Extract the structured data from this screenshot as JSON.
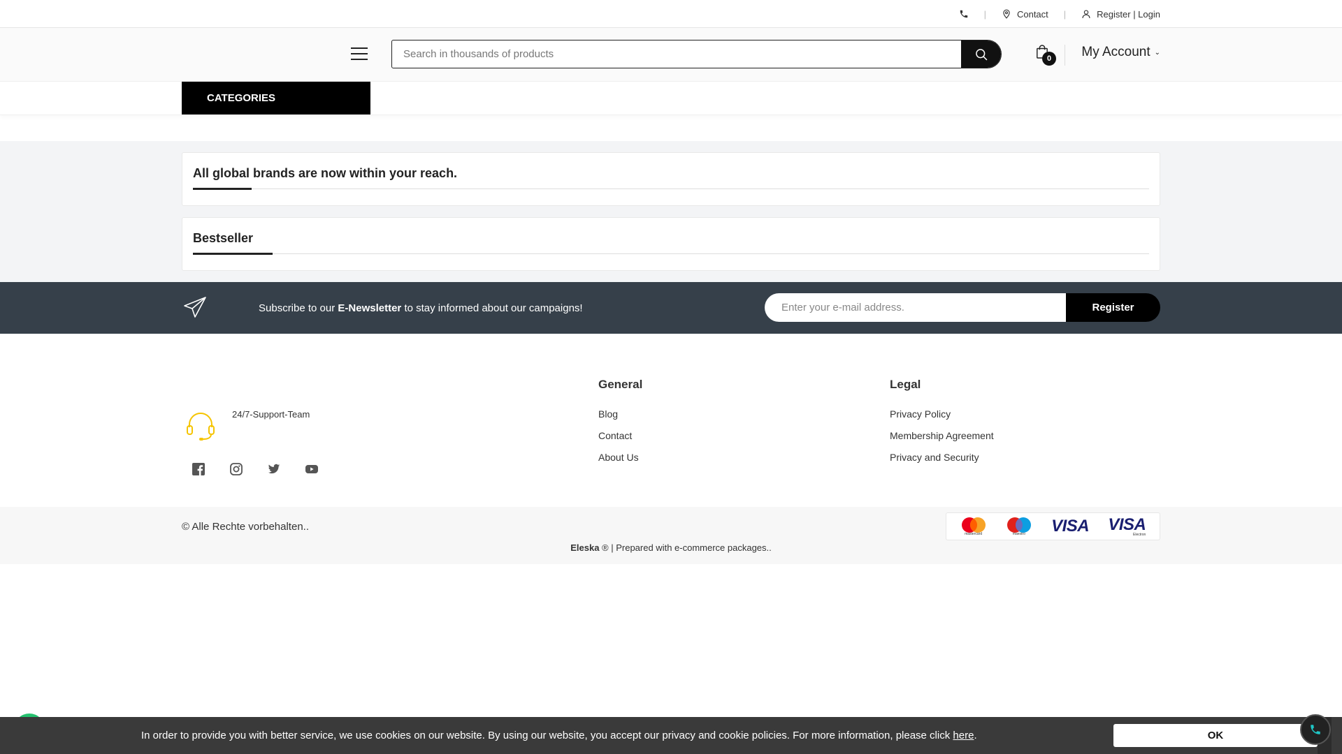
{
  "topbar": {
    "contact_label": "Contact",
    "auth_label": "Register | Login",
    "separator": "|"
  },
  "header": {
    "search_placeholder": "Search in thousands of products",
    "cart_count": "0",
    "account_label": "My Account",
    "account_glyph": "",
    "chevron": "⌄"
  },
  "nav": {
    "categories_label": "CATEGORIES",
    "categories_glyph": ""
  },
  "sections": {
    "brands_title": "All global brands are now within your reach.",
    "bestseller_title": "Bestseller"
  },
  "newsletter": {
    "text_before": "Subscribe to our ",
    "text_bold": "E-Newsletter",
    "text_after": " to stay informed about our campaigns!",
    "email_placeholder": "Enter your e-mail address.",
    "button_label": "Register"
  },
  "footer": {
    "support_text": "24/7-Support-Team",
    "general": {
      "title": "General",
      "links": [
        "Blog",
        "Contact",
        "About Us"
      ]
    },
    "legal": {
      "title": "Legal",
      "links": [
        "Privacy Policy",
        "Membership Agreement",
        "Privacy and Security"
      ]
    },
    "social_icons": [
      "facebook-icon",
      "instagram-icon",
      "twitter-icon",
      "youtube-icon"
    ]
  },
  "bottombar": {
    "copyright": "© Alle Rechte vorbehalten..",
    "credit_brand": "Eleska",
    "credit_rest": " ® | Prepared with e-commerce packages..",
    "payments": {
      "mastercard_label": "mastercard",
      "maestro_label": "maestro",
      "visa_label": "VISA",
      "visa_electron_label": "VISA",
      "electron_sub": "Electron"
    }
  },
  "cookie": {
    "text": "In order to provide you with better service, we use cookies on our website. By using our website, you accept our privacy and cookie policies. For more information, please click ",
    "link_label": "here",
    "suffix": ".",
    "ok_label": "OK"
  },
  "colors": {
    "accent": "#000000",
    "newsletter_bg": "#36404a",
    "support_icon": "#f5c400",
    "whatsapp": "#25c16f",
    "call_icon": "#1fc7c7"
  }
}
